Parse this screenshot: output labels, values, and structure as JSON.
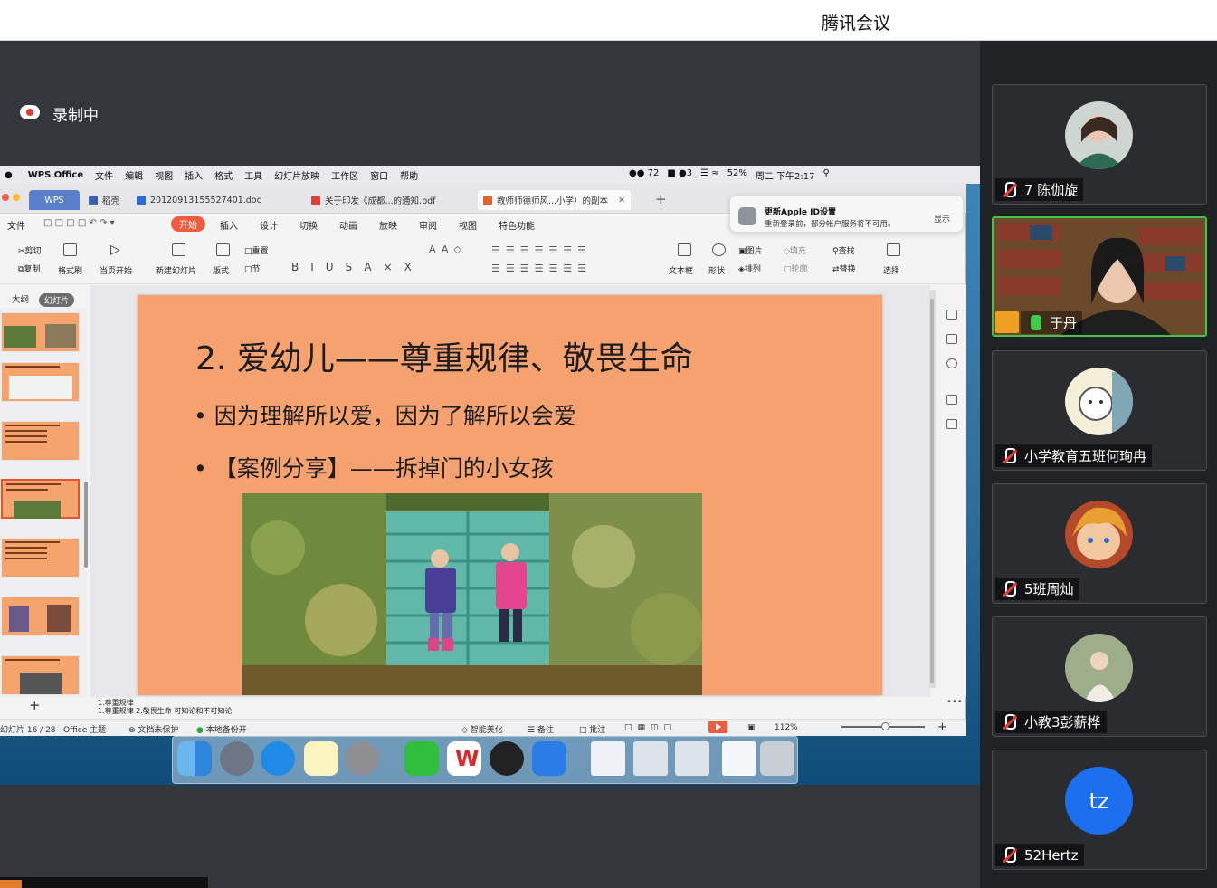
{
  "window": {
    "app_title": "腾讯会议",
    "recording_label": "录制中"
  },
  "mac_menubar": {
    "items": [
      "WPS Office",
      "文件",
      "编辑",
      "视图",
      "插入",
      "格式",
      "工具",
      "幻灯片放映",
      "工作区",
      "窗口",
      "帮助"
    ],
    "tray": {
      "wechat_count": "72",
      "notif_count": "3",
      "battery": "52%",
      "clock": "周二 下午2:17"
    }
  },
  "wps": {
    "tabs": [
      {
        "label": "WPS"
      },
      {
        "label": "稻壳"
      },
      {
        "label": "20120913155527401.doc"
      },
      {
        "label": "关于印发《成都...的通知.pdf"
      },
      {
        "label": "教师师德师风...小学）的副本"
      }
    ],
    "ribbon_tabs": [
      "文件",
      "开始",
      "插入",
      "设计",
      "切换",
      "动画",
      "放映",
      "审阅",
      "视图",
      "特色功能"
    ],
    "toolbar": {
      "cut": "剪切",
      "copy": "复制",
      "format_painter": "格式刷",
      "from_current": "当页开始",
      "new_slide": "新建幻灯片",
      "layout": "版式",
      "reset": "重置",
      "section": "节",
      "textbox": "文本框",
      "shape": "形状",
      "picture": "图片",
      "arrange": "排列",
      "fill": "填充",
      "outline": "轮廓",
      "find": "查找",
      "replace": "替换",
      "select": "选择"
    },
    "notification": {
      "title": "更新Apple ID设置",
      "body": "重新登录前，部分帐户服务将不可用。",
      "action": "显示"
    },
    "panel_tabs": {
      "outline": "大纲",
      "slides": "幻灯片"
    },
    "slide": {
      "title": "2. 爱幼儿——尊重规律、敬畏生命",
      "bullet1": "• 因为理解所以爱，因为了解所以会爱",
      "bullet2": "• 【案例分享】——拆掉门的小女孩"
    },
    "notes": {
      "line1": "1.尊重规律",
      "line2": "1.尊重规律 2.敬畏生命 可知论和不可知论"
    },
    "status": {
      "page": "幻灯片 16 / 28",
      "theme": "Office 主题",
      "protect": "文档未保护",
      "backup": "本地备份开",
      "beautify": "智能美化",
      "notes_btn": "备注",
      "comment": "批注",
      "zoom": "112%"
    }
  },
  "participants": [
    {
      "name": "7 陈伽旋",
      "mic": "muted"
    },
    {
      "name": "于丹",
      "mic": "on"
    },
    {
      "name": "小学教育五班何珣冉",
      "mic": "muted"
    },
    {
      "name": "5班周灿",
      "mic": "muted"
    },
    {
      "name": "小教3彭薪桦",
      "mic": "muted"
    },
    {
      "name": "52Hertz",
      "mic": "muted",
      "initials": "tz"
    }
  ],
  "colors": {
    "accent": "#ef5b3d",
    "slide_bg": "#f6a170",
    "active_speaker": "#45c24a",
    "avatar_blue": "#1e6ff0"
  }
}
